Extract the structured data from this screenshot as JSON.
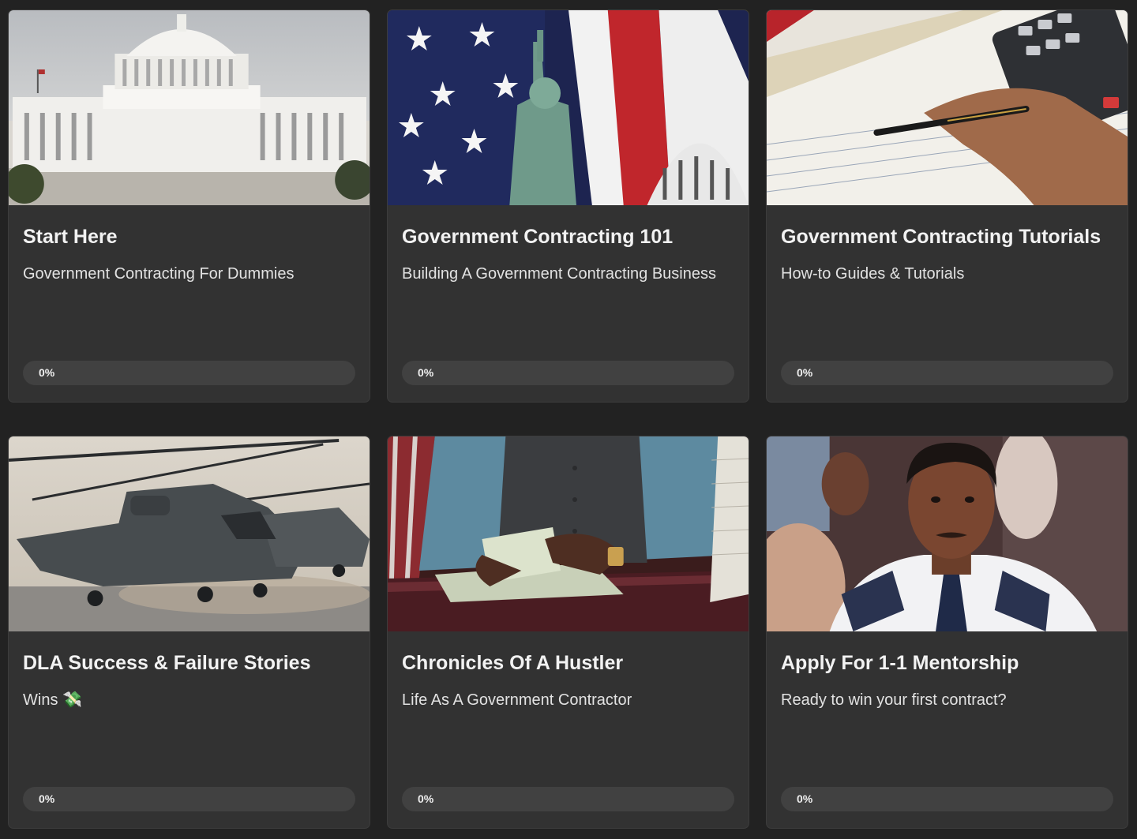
{
  "courses": [
    {
      "title": "Start Here",
      "subtitle": "Government Contracting For Dummies",
      "progress_label": "0%",
      "progress": 0,
      "image": "capitol-building-image"
    },
    {
      "title": "Government Contracting 101",
      "subtitle": "Building A Government Contracting Business",
      "progress_label": "0%",
      "progress": 0,
      "image": "statue-of-liberty-flag-image"
    },
    {
      "title": "Government Contracting Tutorials",
      "subtitle": "How-to Guides & Tutorials",
      "progress_label": "0%",
      "progress": 0,
      "image": "contract-signing-image"
    },
    {
      "title": "DLA Success & Failure Stories",
      "subtitle": "Wins 💸",
      "progress_label": "0%",
      "progress": 0,
      "image": "military-helicopters-image"
    },
    {
      "title": "Chronicles Of A Hustler",
      "subtitle": "Life As A Government Contractor",
      "progress_label": "0%",
      "progress": 0,
      "image": "counting-money-image"
    },
    {
      "title": "Apply For 1-1 Mentorship",
      "subtitle": "Ready to win your first contract?",
      "progress_label": "0%",
      "progress": 0,
      "image": "mentor-portrait-image"
    }
  ],
  "colors": {
    "page_background": "#222222",
    "card_background": "#323232",
    "progress_track": "#414141",
    "text_primary": "#f2f2f2"
  }
}
